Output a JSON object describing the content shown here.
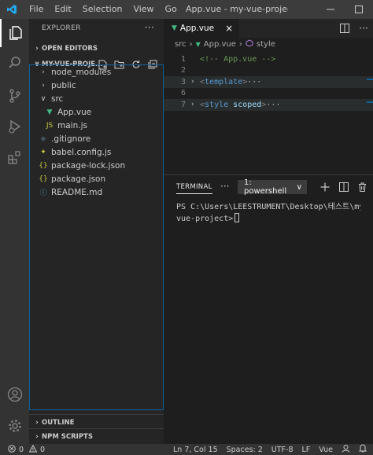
{
  "titlebar": {
    "menu": [
      "File",
      "Edit",
      "Selection",
      "View",
      "Go"
    ],
    "title": "App.vue - my-vue-project - Vi..."
  },
  "sidebar": {
    "header": "EXPLORER",
    "more": "···",
    "open_editors": "OPEN EDITORS",
    "project": "MY-VUE-PROJE...",
    "tree": [
      {
        "label": "node_modules",
        "icon": "chevron-right-icon",
        "glyph": "›",
        "indent": 10,
        "color": "#cccccc"
      },
      {
        "label": "public",
        "icon": "chevron-right-icon",
        "glyph": "›",
        "indent": 10,
        "color": "#cccccc"
      },
      {
        "label": "src",
        "icon": "chevron-down-icon",
        "glyph": "∨",
        "indent": 10,
        "color": "#cccccc"
      },
      {
        "label": "App.vue",
        "icon": "vue-icon",
        "glyph": "▼",
        "indent": 18,
        "color": "#41b883"
      },
      {
        "label": "main.js",
        "icon": "js-icon",
        "glyph": "JS",
        "indent": 18,
        "color": "#cbcb41"
      },
      {
        "label": ".gitignore",
        "icon": "git-icon",
        "glyph": "◆",
        "indent": 10,
        "color": "#41535b"
      },
      {
        "label": "babel.config.js",
        "icon": "babel-icon",
        "glyph": "✦",
        "indent": 10,
        "color": "#cbcb41"
      },
      {
        "label": "package-lock.json",
        "icon": "json-icon",
        "glyph": "{}",
        "indent": 10,
        "color": "#cbcb41"
      },
      {
        "label": "package.json",
        "icon": "json-icon",
        "glyph": "{}",
        "indent": 10,
        "color": "#cbcb41"
      },
      {
        "label": "README.md",
        "icon": "info-icon",
        "glyph": "ⓘ",
        "indent": 10,
        "color": "#519aba"
      }
    ],
    "outline": "OUTLINE",
    "npm_scripts": "NPM SCRIPTS"
  },
  "editor": {
    "tab_label": "App.vue",
    "tab_close": "×",
    "breadcrumb": [
      "src",
      "App.vue",
      "style"
    ],
    "lines": [
      {
        "num": "1",
        "fold": "",
        "comment": "<!-- App.vue -->"
      },
      {
        "num": "2",
        "fold": ""
      },
      {
        "num": "3",
        "fold": "›",
        "tag": "template",
        "attr": "",
        "ellipsis": "···"
      },
      {
        "num": "6",
        "fold": ""
      },
      {
        "num": "7",
        "fold": "›",
        "tag": "style",
        "attr": "scoped",
        "ellipsis": "···"
      },
      {
        "num": "",
        "fold": ""
      }
    ]
  },
  "panel": {
    "tab": "TERMINAL",
    "more": "···",
    "shell": "1: powershell",
    "shell_chevron": "∨",
    "terminal_lines": [
      "PS C:\\Users\\LEESTRUMENT\\Desktop\\테스트\\my-",
      "vue-project>"
    ]
  },
  "statusbar": {
    "errors": "0",
    "warnings": "0",
    "position": "Ln 7, Col 15",
    "spaces": "Spaces: 2",
    "encoding": "UTF-8",
    "eol": "LF",
    "language": "Vue"
  },
  "colors": {
    "accent": "#0e639c",
    "vscode_blue": "#23a9f2",
    "vue_green": "#41b883"
  }
}
